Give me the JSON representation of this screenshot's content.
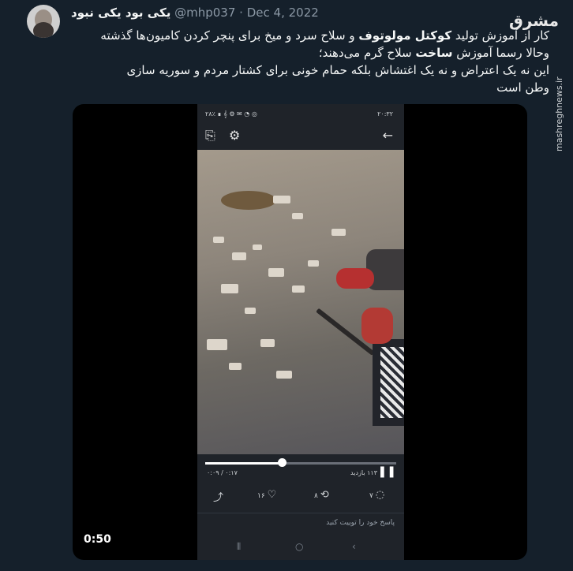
{
  "author": {
    "name": "یکی بود یکی نبود",
    "handle": "@mhp037",
    "separator": "·",
    "date": "Dec 4, 2022"
  },
  "tweet": {
    "line1_a": "کار از آموزش تولید ",
    "line1_bold": "کوکتل مولوتوف",
    "line1_b": " و سلاح سرد و میخ برای پنچر کردن کامیون‌ها گذشته",
    "line2_a": "وحالا رسما آموزش ",
    "line2_bold": "ساخت",
    "line2_b": " سلاح گرم می‌دهند؛",
    "line3": "این نه یک اعتراض و نه یک اغتشاش بلکه حمام خونی برای کشتار مردم و سوریه سازی",
    "line4": "وطن است"
  },
  "site": {
    "logo": "مشرق",
    "watermark": "mashreghnews.ir"
  },
  "video": {
    "duration": "0:50",
    "phone": {
      "status_left": "۲۰:۳۲",
      "status_right": "۲۸٪ ∎ 𝄞 ⚙ ✉ ◔ ◎",
      "progress": 0.4,
      "time_label": "۰:۰۹ / ۰:۱۷",
      "views": "۱۱۳ بازدید",
      "replies": "۷",
      "retweets": "۸",
      "likes": "۱۶",
      "reply_placeholder": "پاسخ خود را توییت کنید"
    }
  }
}
